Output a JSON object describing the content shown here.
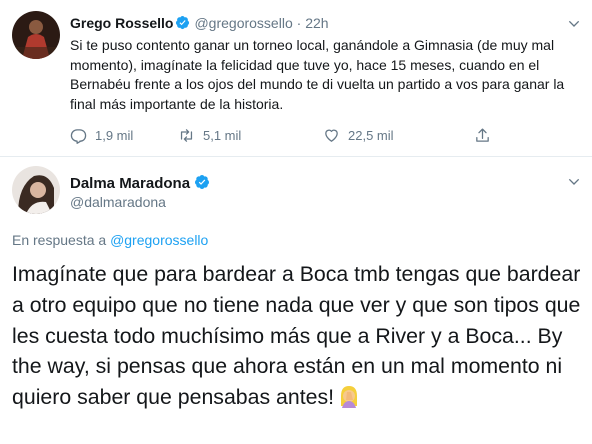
{
  "parent_tweet": {
    "name": "Grego Rossello",
    "handle": "@gregorossello",
    "separator": "·",
    "time": "22h",
    "text": "Si te puso contento ganar un torneo local, ganándole a Gimnasia (de muy mal momento), imagínate la felicidad que tuve yo, hace 15 meses, cuando en el Bernabéu frente a los ojos del mundo te di vuelta un partido a vos para ganar la final más importante de la historia.",
    "replies": "1,9 mil",
    "retweets": "5,1 mil",
    "likes": "22,5 mil",
    "icons": [
      "reply-icon",
      "retweet-icon",
      "like-icon",
      "share-icon",
      "chevron-down-icon",
      "verified-badge-icon"
    ]
  },
  "main_tweet": {
    "name": "Dalma Maradona",
    "handle": "@dalmaradona",
    "reply_prefix": "En respuesta a",
    "reply_to": "@gregorossello",
    "text": "Imagínate que para bardear a Boca tmb tengas que bardear a otro equipo que no tiene nada que ver y que son tipos que les cuesta todo muchísimo más que a River y a Boca... By the way, si pensas que ahora están en un mal momento ni quiero saber que pensabas antes!",
    "emoji": "woman-facepalming-emoji"
  },
  "colors": {
    "accent": "#1da1f2",
    "muted": "#657786",
    "text": "#14171a",
    "border": "#e6ecf0"
  }
}
